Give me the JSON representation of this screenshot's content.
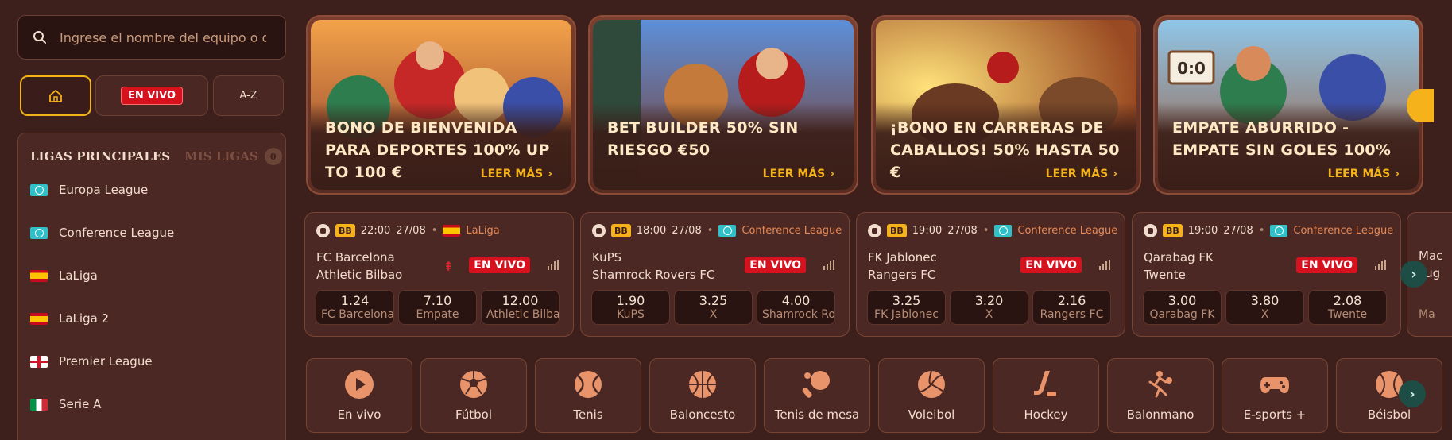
{
  "search": {
    "placeholder": "Ingrese el nombre del equipo o d..."
  },
  "filters": {
    "live_label": "EN VIVO",
    "az_label": "A-Z"
  },
  "leagues_panel": {
    "tab_main": "LIGAS PRINCIPALES",
    "tab_mine": "MIS LIGAS",
    "mine_count": "0",
    "items": [
      {
        "label": "Europa League",
        "flag": "world"
      },
      {
        "label": "Conference League",
        "flag": "world"
      },
      {
        "label": "LaLiga",
        "flag": "es"
      },
      {
        "label": "LaLiga 2",
        "flag": "es"
      },
      {
        "label": "Premier League",
        "flag": "en"
      },
      {
        "label": "Serie A",
        "flag": "it"
      }
    ]
  },
  "promos": [
    {
      "title": "BONO DE BIENVENIDA PARA DEPORTES 100% UP TO 100 €",
      "cta": "LEER MÁS"
    },
    {
      "title": "BET BUILDER 50% SIN RIESGO €50",
      "cta": "LEER MÁS"
    },
    {
      "title": "¡BONO EN CARRERAS DE CABALLOS! 50% HASTA 50 €",
      "cta": "LEER MÁS"
    },
    {
      "title": "EMPATE ABURRIDO - EMPATE SIN GOLES 100%",
      "cta": "LEER MÁS",
      "score_sign": "0:0"
    }
  ],
  "matches": [
    {
      "bb": "BB",
      "time": "22:00",
      "date": "27/08",
      "league": "LaLiga",
      "league_flag": "es",
      "home": "FC Barcelona",
      "away": "Athletic Bilbao",
      "live": "EN VIVO",
      "odds": [
        {
          "value": "1.24",
          "label": "FC Barcelona"
        },
        {
          "value": "7.10",
          "label": "Empate"
        },
        {
          "value": "12.00",
          "label": "Athletic Bilbao"
        }
      ]
    },
    {
      "bb": "BB",
      "time": "18:00",
      "date": "27/08",
      "league": "Conference League",
      "league_flag": "world",
      "home": "KuPS",
      "away": "Shamrock Rovers FC",
      "live": "EN VIVO",
      "odds": [
        {
          "value": "1.90",
          "label": "KuPS"
        },
        {
          "value": "3.25",
          "label": "X"
        },
        {
          "value": "4.00",
          "label": "Shamrock Rovers FC"
        }
      ]
    },
    {
      "bb": "BB",
      "time": "19:00",
      "date": "27/08",
      "league": "Conference League",
      "league_flag": "world",
      "home": "FK Jablonec",
      "away": "Rangers FC",
      "live": "EN VIVO",
      "odds": [
        {
          "value": "3.25",
          "label": "FK Jablonec"
        },
        {
          "value": "3.20",
          "label": "X"
        },
        {
          "value": "2.16",
          "label": "Rangers FC"
        }
      ]
    },
    {
      "bb": "BB",
      "time": "19:00",
      "date": "27/08",
      "league": "Conference League",
      "league_flag": "world",
      "home": "Qarabag FK",
      "away": "Twente",
      "live": "EN VIVO",
      "odds": [
        {
          "value": "3.00",
          "label": "Qarabag FK"
        },
        {
          "value": "3.80",
          "label": "X"
        },
        {
          "value": "2.08",
          "label": "Twente"
        }
      ]
    }
  ],
  "peek_card": {
    "line1": "Mac",
    "line2": "Lug",
    "odd_label": "Ma"
  },
  "sports": [
    {
      "label": "En vivo",
      "icon": "play-icon"
    },
    {
      "label": "Fútbol",
      "icon": "soccer-ball-icon"
    },
    {
      "label": "Tenis",
      "icon": "tennis-ball-icon"
    },
    {
      "label": "Baloncesto",
      "icon": "basketball-icon"
    },
    {
      "label": "Tenis de mesa",
      "icon": "table-tennis-icon"
    },
    {
      "label": "Voleibol",
      "icon": "volleyball-icon"
    },
    {
      "label": "Hockey",
      "icon": "hockey-icon"
    },
    {
      "label": "Balonmano",
      "icon": "handball-icon"
    },
    {
      "label": "E-sports +",
      "icon": "gamepad-icon"
    },
    {
      "label": "Béisbol",
      "icon": "baseball-icon"
    }
  ],
  "colors": {
    "accent": "#f5b21b",
    "live": "#d6121f",
    "bg": "#3d1f1c",
    "card": "#4b2824",
    "league_text": "#e78a56"
  }
}
